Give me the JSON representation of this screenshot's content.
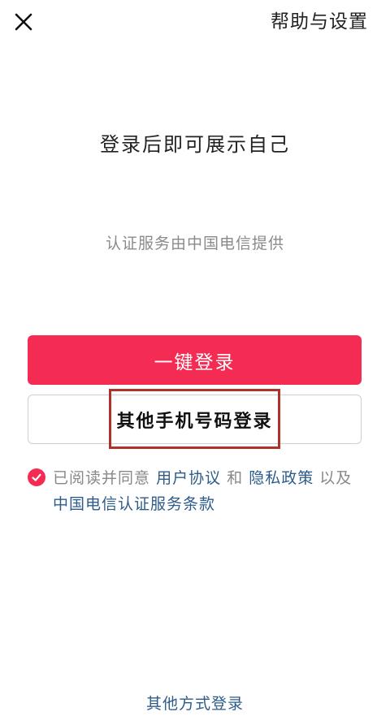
{
  "header": {
    "close_icon": "close-icon",
    "help_settings_label": "帮助与设置"
  },
  "main": {
    "headline": "登录后即可展示自己",
    "auth_note": "认证服务由中国电信提供",
    "one_click_login_label": "一键登录",
    "other_phone_login_label": "其他手机号码登录"
  },
  "agreement": {
    "checked": true,
    "prefix": "已阅读并同意",
    "user_agreement": "用户协议",
    "and": "和",
    "privacy_policy": "隐私政策",
    "and_also": "以及",
    "telecom_terms": "中国电信认证服务条款"
  },
  "footer": {
    "other_methods_label": "其他方式登录"
  },
  "colors": {
    "primary": "#f42c53",
    "link": "#2d5c8a",
    "highlight_border": "#b0302a"
  }
}
